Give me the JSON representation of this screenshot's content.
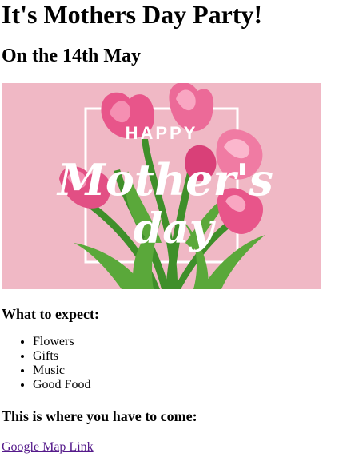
{
  "page": {
    "title": "It's Mothers Day Party!",
    "subtitle": "On the 14th May",
    "banner": {
      "word_happy": "HAPPY",
      "word_mothers": "Mother's",
      "word_day": "day",
      "background_color": "#f0b8c5"
    },
    "expect_heading": "What to expect:",
    "expect_items": [
      "Flowers",
      "Gifts",
      "Music",
      "Good Food"
    ],
    "where_heading": "This is where you have to come:",
    "map_link_text": "Google Map Link",
    "link_color": "#551a8b"
  }
}
